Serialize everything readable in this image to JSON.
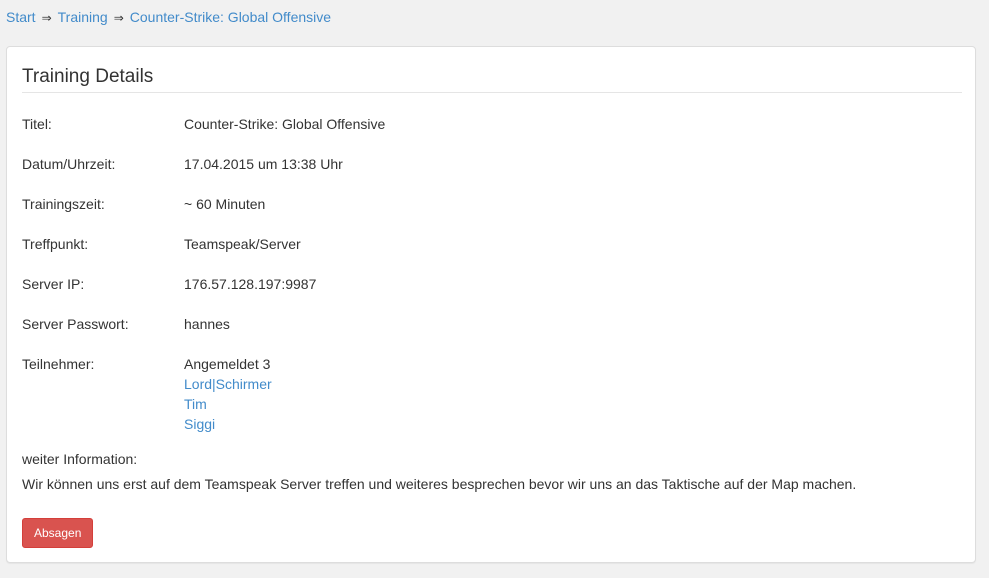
{
  "breadcrumb": {
    "items": [
      "Start",
      "Training",
      "Counter-Strike: Global Offensive"
    ],
    "separator": "⇒"
  },
  "panel": {
    "title": "Training Details",
    "fields": {
      "titel": {
        "label": "Titel:",
        "value": "Counter-Strike: Global Offensive"
      },
      "datum": {
        "label": "Datum/Uhrzeit:",
        "value": "17.04.2015 um 13:38 Uhr"
      },
      "trainingszeit": {
        "label": "Trainingszeit:",
        "value": "~ 60 Minuten"
      },
      "treffpunkt": {
        "label": "Treffpunkt:",
        "value": "Teamspeak/Server"
      },
      "server_ip": {
        "label": "Server IP:",
        "value": "176.57.128.197:9987"
      },
      "server_passwort": {
        "label": "Server Passwort:",
        "value": "hannes"
      }
    },
    "participants": {
      "label": "Teilnehmer:",
      "summary": "Angemeldet 3",
      "names": [
        "Lord|Schirmer",
        "Tim",
        "Siggi"
      ]
    },
    "info": {
      "label": "weiter Information:",
      "text": "Wir können uns erst auf dem Teamspeak Server treffen und weiteres besprechen bevor wir uns an das Taktische auf der Map machen."
    },
    "cancel_button": "Absagen"
  },
  "colors": {
    "link": "#428bca",
    "danger": "#d9534f",
    "background": "#f1f1f1"
  }
}
